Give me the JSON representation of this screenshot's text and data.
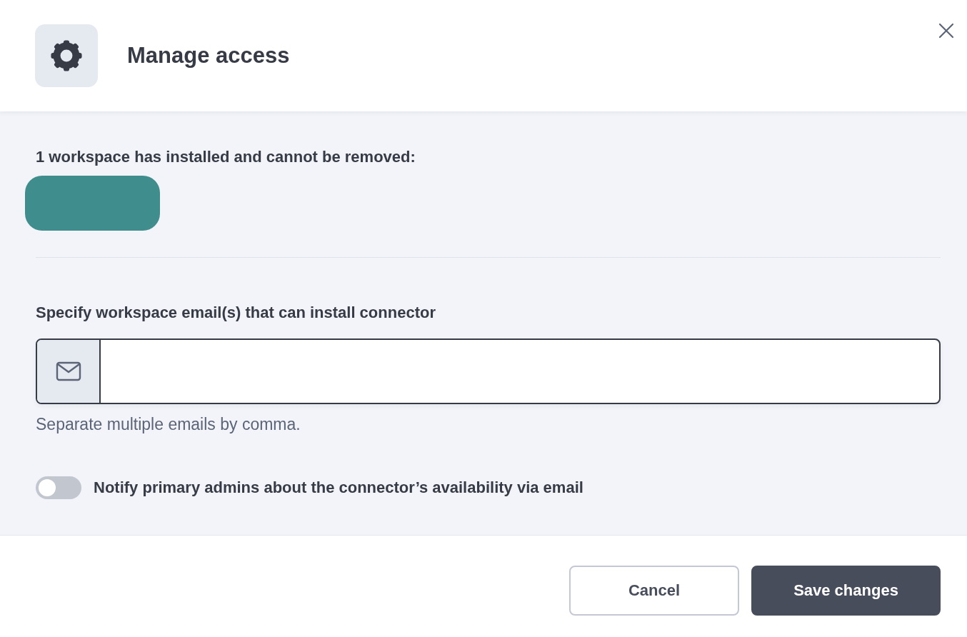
{
  "dialog": {
    "title": "Manage access"
  },
  "installed_notice": "1 workspace has installed and cannot be removed:",
  "email_field": {
    "label": "Specify workspace email(s) that can install connector",
    "helper": "Separate multiple emails by comma."
  },
  "notify_toggle": {
    "label": "Notify primary admins about the connector’s availability via email",
    "on": false
  },
  "buttons": [
    {
      "label": "Cancel",
      "kind": "secondary"
    },
    {
      "label": "Save changes",
      "kind": "primary"
    }
  ]
}
